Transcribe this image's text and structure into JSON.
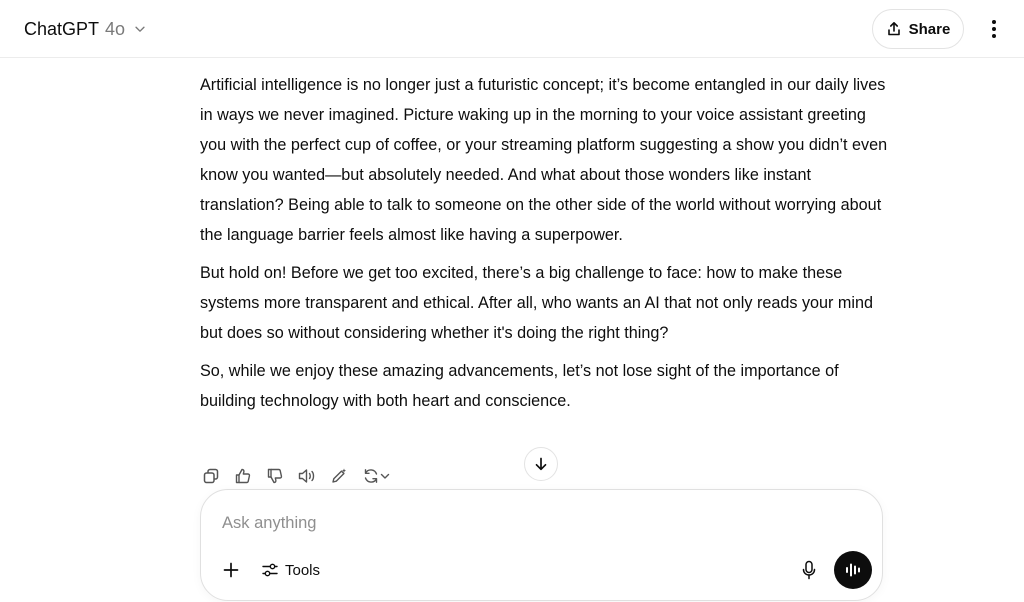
{
  "header": {
    "model_name": "ChatGPT",
    "model_version": "4o",
    "share_label": "Share",
    "icons": [
      "chevron-down-icon",
      "share-icon",
      "more-vertical-icon"
    ]
  },
  "message": {
    "paragraphs": [
      "Artificial intelligence is no longer just a futuristic concept; it’s become entangled in our daily lives in ways we never imagined. Picture waking up in the morning to your voice assistant greeting you with the perfect cup of coffee, or your streaming platform suggesting a show you didn’t even know you wanted—but absolutely needed. And what about those wonders like instant translation? Being able to talk to someone on the other side of the world without worrying about the language barrier feels almost like having a superpower.",
      "But hold on! Before we get too excited, there’s a big challenge to face: how to make these systems more transparent and ethical. After all, who wants an AI that not only reads your mind but does so without considering whether it's doing the right thing?",
      "So, while we enjoy these amazing advancements, let’s not lose sight of the importance of building technology with both heart and conscience."
    ]
  },
  "message_actions": {
    "icons": [
      "copy-icon",
      "thumbs-up-icon",
      "thumbs-down-icon",
      "read-aloud-icon",
      "edit-in-canvas-icon",
      "regenerate-icon"
    ]
  },
  "composer": {
    "placeholder": "Ask anything",
    "tools_label": "Tools",
    "icons": [
      "plus-icon",
      "tools-icon",
      "mic-icon",
      "voice-mode-icon",
      "arrow-down-icon"
    ]
  },
  "colors": {
    "text": "#0d0d0d",
    "muted": "#7a7a7a",
    "border": "#e3e3e3",
    "voice_button": "#0d0d0d"
  }
}
